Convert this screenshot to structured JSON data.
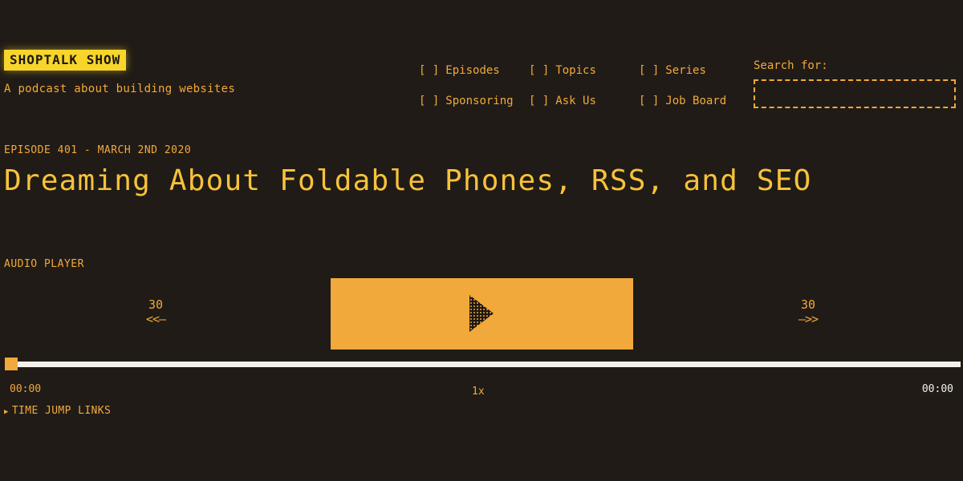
{
  "brand": {
    "logo": "SHOPTALK SHOW",
    "tagline": "A podcast about building websites"
  },
  "nav": {
    "bracket": "[ ]",
    "items": [
      {
        "label": "Episodes"
      },
      {
        "label": "Topics"
      },
      {
        "label": "Series"
      },
      {
        "label": "Sponsoring"
      },
      {
        "label": "Ask Us"
      },
      {
        "label": "Job Board"
      }
    ]
  },
  "search": {
    "label": "Search for:",
    "value": "",
    "placeholder": ""
  },
  "episode": {
    "meta": "EPISODE 401 - MARCH 2ND 2020",
    "title": "Dreaming About Foldable Phones, RSS, and SEO"
  },
  "player": {
    "heading": "AUDIO PLAYER",
    "skip_back": {
      "amount": "30",
      "arrow": "<<—"
    },
    "skip_forward": {
      "amount": "30",
      "arrow": "—>>"
    },
    "play_icon": "play-icon",
    "progress": 0,
    "current_time": "00:00",
    "total_time": "00:00",
    "speed": "1x"
  },
  "time_jump": {
    "marker": "▶",
    "label": "TIME JUMP LINKS"
  },
  "colors": {
    "background": "#201b16",
    "accent": "#f2a93b",
    "logo_bg": "#f7d52a",
    "track": "#f4f1ea"
  }
}
